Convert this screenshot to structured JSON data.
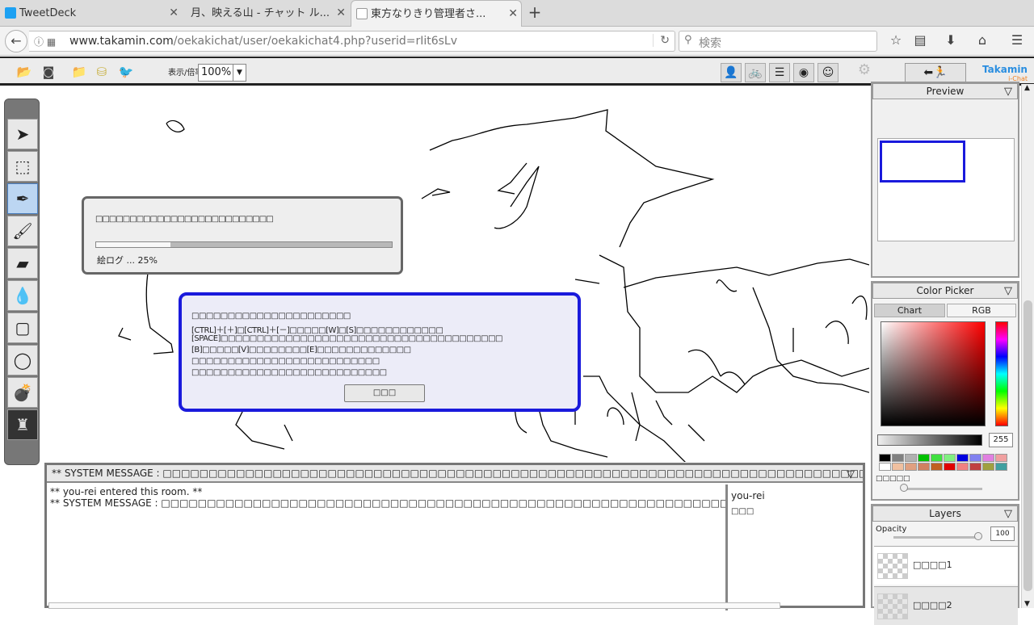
{
  "browser": {
    "tabs": [
      {
        "label": "TweetDeck",
        "icon": "twitter-icon"
      },
      {
        "label": "月、映える山 - チャット ル...",
        "icon": "none"
      },
      {
        "label": "東方なりきり管理者さ...",
        "icon": "panda-icon"
      }
    ],
    "url_domain": "www.takamin.com",
    "url_path": "/oekakichat/user/oekakichat4.php?userid=rIit6sLv",
    "search_placeholder": "検索"
  },
  "app": {
    "zoom_label": "表示/倍率",
    "zoom_value": "100%",
    "exit_label": "⬅🏃",
    "logo": "Takamin",
    "logo_sub": "i-Chat",
    "progress": {
      "message": "□□□□□□□□□□□□□□□□□□□□□□□□□□",
      "label": "絵ログ ... 25%",
      "fraction": 0.25
    },
    "help": {
      "lines": [
        "□□□□□□□□□□□□□□□□□□□□□□",
        "[CTRL]＋[＋]□[CTRL]＋[－]□□□□□[W]□[S]□□□□□□□□□□□□",
        "[SPACE]□□□□□□□□□□□□□□□□□□□□□□□□□□□□□□□□□□□□□□□",
        "[B]□□□□□[V]□□□□□□□□[E]□□□□□□□□□□□□□",
        "□□□□□□□□□□□□□□□□□□□□□□□□□□",
        "□□□□□□□□□□□□□□□□□□□□□□□□□□□"
      ],
      "close_label": "□□□"
    },
    "preview_title": "Preview",
    "colorpicker": {
      "title": "Color Picker",
      "tab_chart": "Chart",
      "tab_rgb": "RGB",
      "alpha_value": "255",
      "label": "□□□□□",
      "swatches": [
        "#000000",
        "#808080",
        "#b0b0b0",
        "#00c000",
        "#40e040",
        "#80f080",
        "#0000e0",
        "#8080f0",
        "#e080e0",
        "#f0a0a0",
        "#ffffff",
        "#f0c0a0",
        "#e0a080",
        "#d08060",
        "#c06020",
        "#e00000",
        "#f08080",
        "#c04040",
        "#a0a040",
        "#40a0a0"
      ]
    },
    "layers": {
      "title": "Layers",
      "opacity_label": "Opacity",
      "opacity_value": "100",
      "items": [
        "□□□□1",
        "□□□□2"
      ]
    },
    "chat": {
      "header": "** SYSTEM MESSAGE : □□□□□□□□□□□□□□□□□□□□□□□□□□□□□□□□□□□□□□□□□□□□□□□□□□□□□□□□□□□□□□□□□□□□□□□□□□□□□□□□□□□□□",
      "log": [
        "** you-rei entered this room. **",
        "** SYSTEM MESSAGE : □□□□□□□□□□□□□□□□□□□□□□□□□□□□□□□□□□□□□□□□□□□□□□□□□□□□□□□□□□□□□□□□□□□□□□□□□□□□□□□□□□□□□"
      ],
      "users": [
        "you-rei",
        "□□□"
      ]
    }
  }
}
